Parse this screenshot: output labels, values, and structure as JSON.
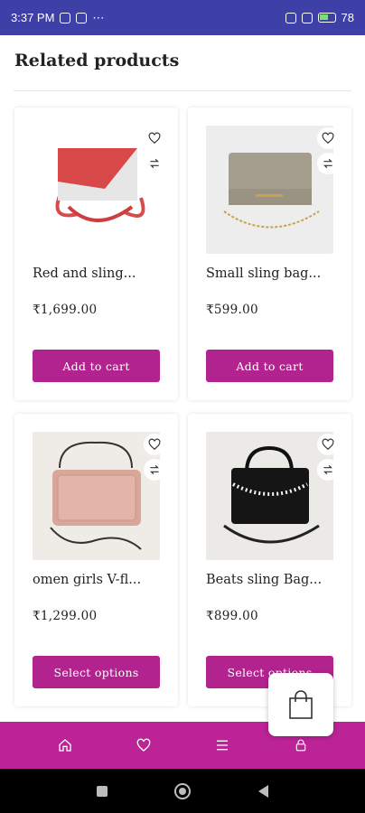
{
  "status_bar": {
    "time": "3:37 PM",
    "battery": "78"
  },
  "section_title": "Related products",
  "products": [
    {
      "name": "Red and sling...",
      "price": "₹1,699.00",
      "button": "Add to cart"
    },
    {
      "name": "Small sling bag...",
      "price": "₹599.00",
      "button": "Add to cart"
    },
    {
      "name": "omen girls V-fl...",
      "price": "₹1,299.00",
      "button": "Select options"
    },
    {
      "name": "Beats sling Bag...",
      "price": "₹899.00",
      "button": "Select options"
    }
  ],
  "bottom_nav": {
    "items": [
      "home-icon",
      "heart-icon",
      "menu-icon",
      "lock-icon"
    ]
  },
  "colors": {
    "accent": "#b3238f",
    "nav_bg": "#bb2397",
    "status_bg": "#3f3fa8"
  }
}
